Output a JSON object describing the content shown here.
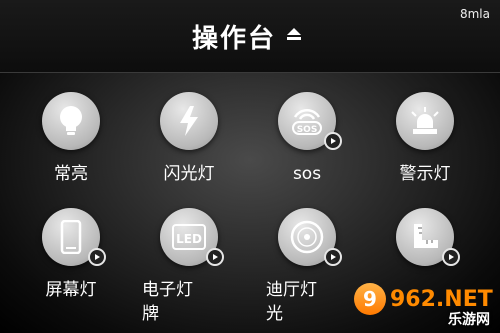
{
  "header": {
    "title": "操作台",
    "corner_text": "8mla"
  },
  "tiles": [
    {
      "label": "常亮",
      "icon": "bulb-icon",
      "has_play": false
    },
    {
      "label": "闪光灯",
      "icon": "flash-icon",
      "has_play": false
    },
    {
      "label": "sos",
      "icon": "sos-icon",
      "icon_text": "SOS",
      "has_play": true
    },
    {
      "label": "警示灯",
      "icon": "siren-icon",
      "has_play": false
    },
    {
      "label": "屏幕灯",
      "icon": "phone-icon",
      "has_play": true
    },
    {
      "label": "电子灯\n牌",
      "icon": "led-sign-icon",
      "icon_text": "LED",
      "has_play": true
    },
    {
      "label": "迪厅灯\n光",
      "icon": "disc-icon",
      "has_play": true
    },
    {
      "label": "",
      "icon": "ruler-icon",
      "has_play": true
    }
  ],
  "watermark": {
    "brand": "962.NET",
    "sub": "乐游网"
  },
  "colors": {
    "accent": "#ff8a00",
    "icon_fill": "#d0d0d0",
    "glyph": "#ffffff"
  }
}
